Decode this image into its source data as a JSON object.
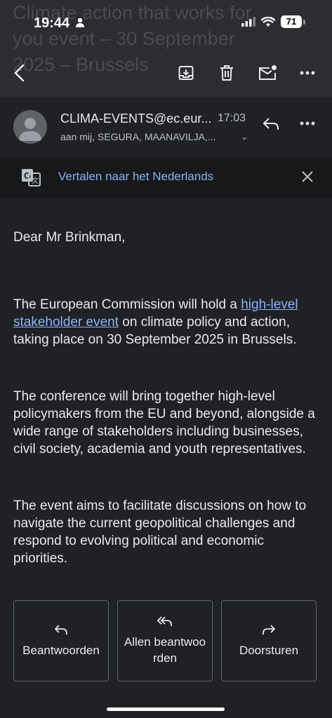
{
  "status_bar": {
    "time": "19:44",
    "battery": "71"
  },
  "subject": "Climate action that works for\nyou event – 30 September\n2025 – Brussels",
  "toolbar": {
    "back_icon": "arrow-left-icon",
    "archive_icon": "archive-icon",
    "delete_icon": "trash-icon",
    "mark_unread_icon": "mail-unread-icon",
    "more_icon": "more-horizontal-icon"
  },
  "message": {
    "sender": "CLIMA-EVENTS@ec.eur...",
    "time": "17:03",
    "recipients": "aan mij, SEGURA, MAANAVILJA,..."
  },
  "translate": {
    "label": "Vertalen naar het Nederlands"
  },
  "body": {
    "greeting": "Dear Mr Brinkman,",
    "p1_before": "The European Commission will hold a ",
    "p1_link": "high-level stakeholder event",
    "p1_after": " on climate policy and action, taking place on 30 September 2025 in Brussels.",
    "p2": "The conference will bring together high-level policymakers from the EU and beyond, alongside a wide range of stakeholders including businesses, civil society, academia and youth representatives.",
    "p3": "The event aims to facilitate discussions on how to navigate the current geopolitical challenges and respond to evolving political and economic priorities."
  },
  "actions": {
    "reply": "Beantwoorden",
    "reply_all": "Allen beantwoorden",
    "forward": "Doorsturen"
  }
}
